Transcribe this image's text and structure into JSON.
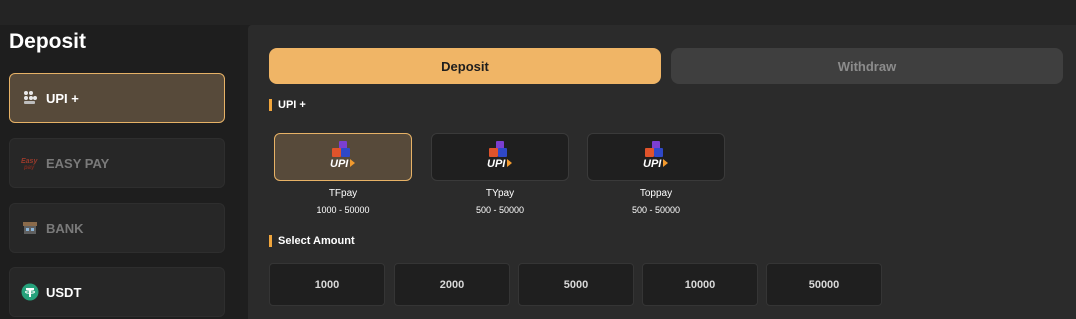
{
  "page": {
    "title": "Deposit"
  },
  "methods": [
    {
      "label": "UPI +",
      "icon": "upi-people-icon",
      "active": true
    },
    {
      "label": "EASY PAY",
      "icon": "easypay-logo-icon",
      "active": false
    },
    {
      "label": "BANK",
      "icon": "bank-icon",
      "active": false
    },
    {
      "label": "USDT",
      "icon": "tether-icon",
      "active": false
    }
  ],
  "tabs": {
    "deposit": "Deposit",
    "withdraw": "Withdraw"
  },
  "sections": {
    "channel": "UPI +",
    "amount": "Select Amount"
  },
  "channels": [
    {
      "name": "TFpay",
      "range": "1000 - 50000",
      "icon": "upi-logo-icon",
      "active": true
    },
    {
      "name": "TYpay",
      "range": "500 - 50000",
      "icon": "upi-logo-icon",
      "active": false
    },
    {
      "name": "Toppay",
      "range": "500 - 50000",
      "icon": "upi-logo-icon",
      "active": false
    }
  ],
  "amounts": [
    "1000",
    "2000",
    "5000",
    "10000",
    "50000"
  ],
  "colors": {
    "accent": "#f0b566",
    "active_bg": "#574a3a",
    "panel": "#2b2b2b"
  }
}
